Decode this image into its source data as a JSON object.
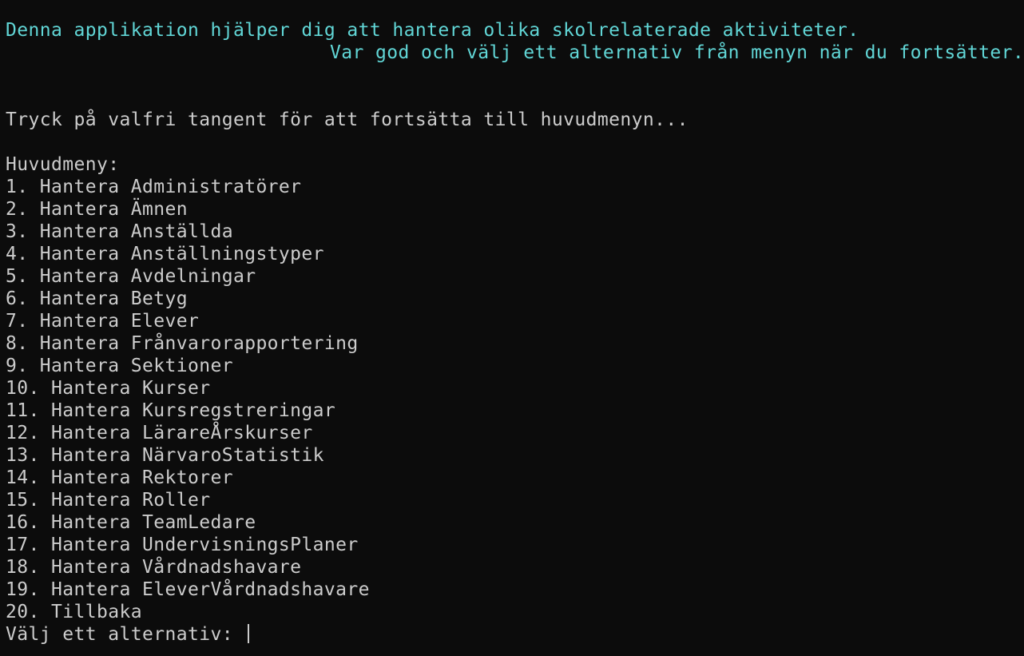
{
  "intro": {
    "line1": "Denna applikation hjälper dig att hantera olika skolrelaterade aktiviteter.",
    "line2": "Var god och välj ett alternativ från menyn när du fortsätter."
  },
  "continue_prompt": "Tryck på valfri tangent för att fortsätta till huvudmenyn...",
  "menu": {
    "title": "Huvudmeny:",
    "items": [
      "1. Hantera Administratörer",
      "2. Hantera Ämnen",
      "3. Hantera Anställda",
      "4. Hantera Anställningstyper",
      "5. Hantera Avdelningar",
      "6. Hantera Betyg",
      "7. Hantera Elever",
      "8. Hantera Frånvarorapportering",
      "9. Hantera Sektioner",
      "10. Hantera Kurser",
      "11. Hantera Kursregstreringar",
      "12. Hantera LärareÅrskurser",
      "13. Hantera NärvaroStatistik",
      "14. Hantera Rektorer",
      "15. Hantera Roller",
      "16. Hantera TeamLedare",
      "17. Hantera UndervisningsPlaner",
      "18. Hantera Vårdnadshavare",
      "19. Hantera EleverVårdnadshavare",
      "20. Tillbaka"
    ]
  },
  "input_prompt": "Välj ett alternativ: ",
  "colors": {
    "background": "#0c0c0c",
    "text": "#cccccc",
    "accent": "#61d6d6"
  }
}
